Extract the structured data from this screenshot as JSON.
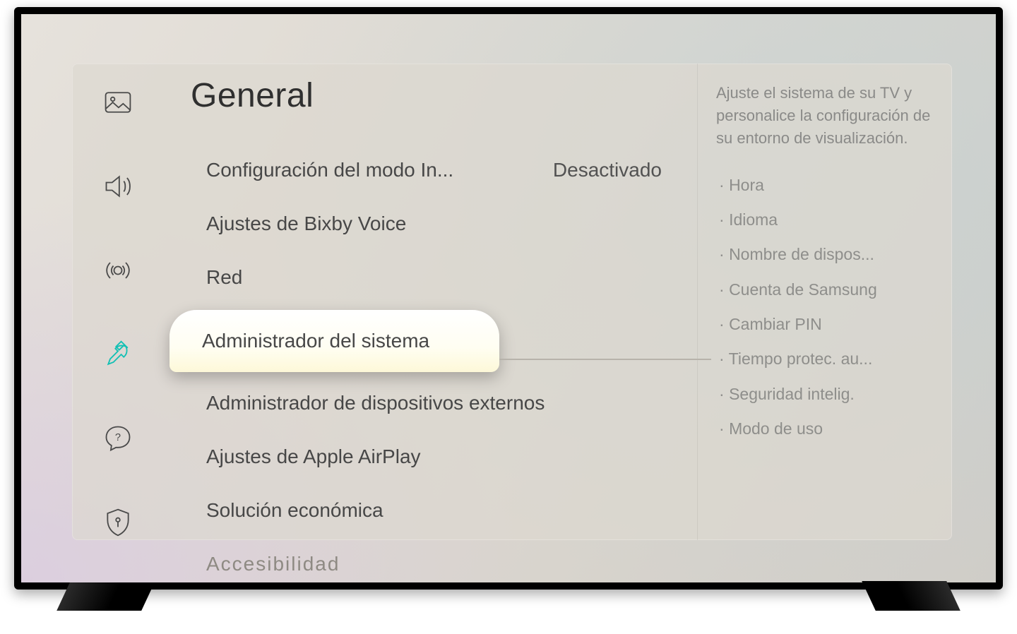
{
  "section_title": "General",
  "nav": [
    {
      "name": "picture"
    },
    {
      "name": "sound"
    },
    {
      "name": "broadcast"
    },
    {
      "name": "general",
      "active": true
    },
    {
      "name": "support"
    },
    {
      "name": "privacy"
    }
  ],
  "menu": {
    "items": [
      {
        "label": "Configuración del modo In...",
        "value": "Desactivado"
      },
      {
        "label": "Ajustes de Bixby Voice",
        "value": ""
      },
      {
        "label": "Red",
        "value": ""
      },
      {
        "label": "Administrador del sistema",
        "value": "",
        "selected": true
      },
      {
        "label": "Administrador de dispositivos externos",
        "value": ""
      },
      {
        "label": "Ajustes de Apple AirPlay",
        "value": ""
      },
      {
        "label": "Solución económica",
        "value": ""
      },
      {
        "label": "Accesibilidad",
        "value": "",
        "cut": true
      }
    ]
  },
  "info": {
    "description": "Ajuste el sistema de su TV y personalice la configuración de su entorno de visualización.",
    "items": [
      "Hora",
      "Idioma",
      "Nombre de dispos...",
      "Cuenta de Samsung",
      "Cambiar PIN",
      "Tiempo protec. au...",
      "Seguridad intelig.",
      "Modo de uso"
    ]
  }
}
